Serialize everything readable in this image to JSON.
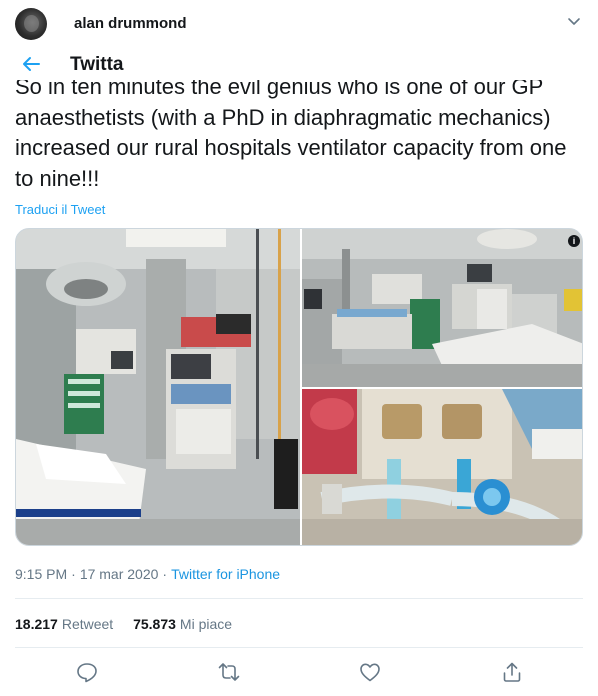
{
  "author": {
    "name": "alan drummond"
  },
  "header": {
    "title": "Twitta"
  },
  "tweet": {
    "text": "So in ten minutes the evil genius who is one of our GP anaesthetists (with a PhD in diaphragmatic mechanics) increased our rural hospitals ventilator capacity from one to nine!!!",
    "translate_label": "Traduci il Tweet"
  },
  "media": {
    "info_badge": "i"
  },
  "meta": {
    "time": "9:15 PM",
    "separator": "·",
    "date": "17 mar 2020",
    "source": "Twitter for iPhone"
  },
  "stats": {
    "retweets_count": "18.217",
    "retweets_label": "Retweet",
    "likes_count": "75.873",
    "likes_label": "Mi piace"
  },
  "icons": {
    "back": "arrow-left-icon",
    "menu": "chevron-down-icon",
    "reply": "reply-icon",
    "retweet": "retweet-icon",
    "like": "heart-icon",
    "share": "share-icon"
  },
  "colors": {
    "accent": "#1da1f2",
    "text": "#14171a",
    "secondary": "#657786",
    "divider": "#e6ecf0"
  }
}
